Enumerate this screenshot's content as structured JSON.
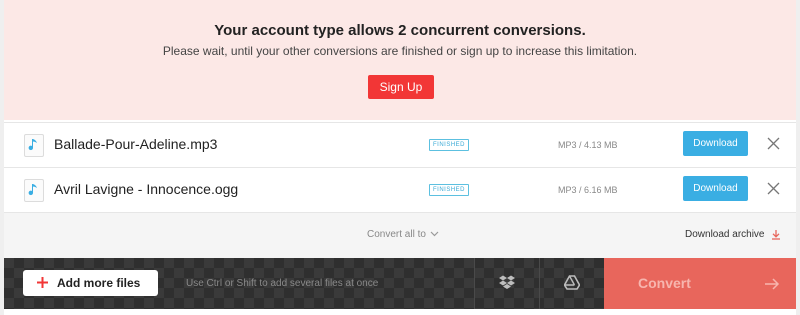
{
  "notice": {
    "title": "Your account type allows 2 concurrent conversions.",
    "message": "Please wait, until your other conversions are finished or sign up to increase this limitation.",
    "signup_label": "Sign Up"
  },
  "files": [
    {
      "name": "Ballade-Pour-Adeline.mp3",
      "status": "FINISHED",
      "meta": "MP3 / 4.13 MB",
      "download_label": "Download",
      "icon": "audio-file-icon"
    },
    {
      "name": "Avril Lavigne - Innocence.ogg",
      "status": "FINISHED",
      "meta": "MP3 / 6.16 MB",
      "download_label": "Download",
      "icon": "audio-file-icon"
    }
  ],
  "options": {
    "convert_all_label": "Convert all to",
    "download_archive_label": "Download archive"
  },
  "bottom": {
    "add_files_label": "Add more files",
    "hint": "Use Ctrl or Shift to add several files at once",
    "convert_label": "Convert"
  },
  "colors": {
    "notice_bg": "#fce8e6",
    "signup": "#f23636",
    "download": "#3aaee3",
    "status": "#3aaad6",
    "convert": "#e8665c"
  }
}
